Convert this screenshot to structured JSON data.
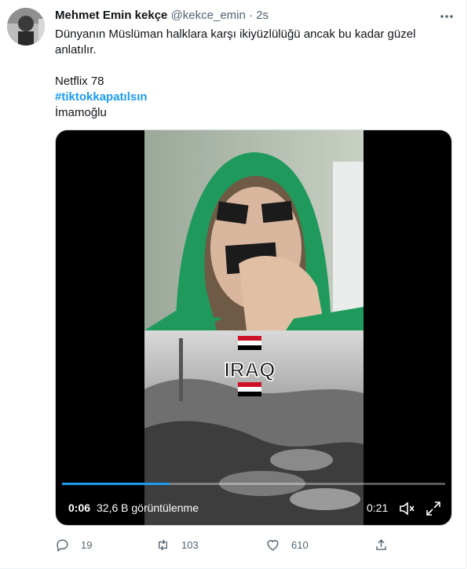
{
  "author": {
    "name": "Mehmet Emin kekçe",
    "handle": "@kekce_emin",
    "separator": "·",
    "time": "2s"
  },
  "tweet": {
    "line1": "Dünyanın Müslüman halklara karşı ikiyüzlülüğü ancak bu kadar güzel",
    "line2": "anlatılır.",
    "line3": "Netflix 78",
    "hashtag": "#tiktokkapatılsın",
    "line5": "İmamoğlu"
  },
  "video": {
    "overlay_text": "IRAQ",
    "current_time": "0:06",
    "views": "32,6 B görüntülenme",
    "duration": "0:21",
    "progress": 0.28
  },
  "actions": {
    "replies": "19",
    "retweets": "103",
    "likes": "610"
  },
  "colors": {
    "link": "#1d9bf0",
    "muted": "#536471",
    "hood_green": "#1f9a5c"
  },
  "icons": [
    "more-icon",
    "reply-icon",
    "retweet-icon",
    "like-icon",
    "share-icon",
    "mute-icon",
    "fullscreen-icon"
  ]
}
